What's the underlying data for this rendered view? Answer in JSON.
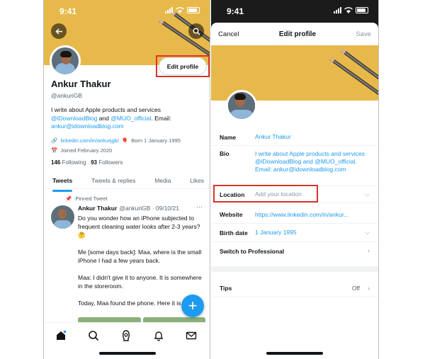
{
  "left": {
    "status_time": "9:41",
    "profile": {
      "edit_button": "Edit profile",
      "name": "Ankur Thakur",
      "handle": "@ankuriGB",
      "bio_line1": "I write about Apple products and services",
      "bio_link1": "@iDownloadBlog",
      "bio_and": " and ",
      "bio_link2": "@MUO_official",
      "bio_email_label": ". Email:",
      "bio_email": "ankur@idownloadblog.com",
      "link": "linkedin.com/in/ankurjgb/",
      "born": "Born 1 January 1995",
      "joined": "Joined February 2020",
      "following_count": "146",
      "following_label": "Following",
      "followers_count": "93",
      "followers_label": "Followers"
    },
    "tabs": [
      "Tweets",
      "Tweets & replies",
      "Media",
      "Likes"
    ],
    "tweet": {
      "pinned": "Pinned Tweet",
      "author": "Ankur Thakur",
      "handle_date": "@ankuriGB · 09/10/21",
      "more": "···",
      "p1": "Do you wonder how an iPhone subjected to frequent cleaning water looks after 2-3 years?🤔",
      "p2": "Me [some days back]: Maa, where is the small iPhone I had a few years back.",
      "p3": "Maa: I didn't give it to anyone. It is somewhere in the storeroom.",
      "p4": "Today, Maa found the phone. Here it is. 😂"
    },
    "fab": "+"
  },
  "right": {
    "status_time": "9:41",
    "cancel": "Cancel",
    "title": "Edit profile",
    "save": "Save",
    "fields": {
      "name_label": "Name",
      "name_value": "Ankur Thakur",
      "bio_label": "Bio",
      "bio_value": "I write about Apple products and services @iDownloadBlog and @MUO_official. Email: ankur@idownloadblog.com",
      "location_label": "Location",
      "location_placeholder": "Add your location",
      "website_label": "Website",
      "website_value": "https://www.linkedin.com/in/ankur...",
      "birth_label": "Birth date",
      "birth_value": "1 January 1995",
      "professional": "Switch to Professional",
      "tips_label": "Tips",
      "tips_value": "Off"
    }
  },
  "colors": {
    "accent": "#1d9bf0",
    "banner": "#e7b94a",
    "highlight": "#d9342b"
  }
}
